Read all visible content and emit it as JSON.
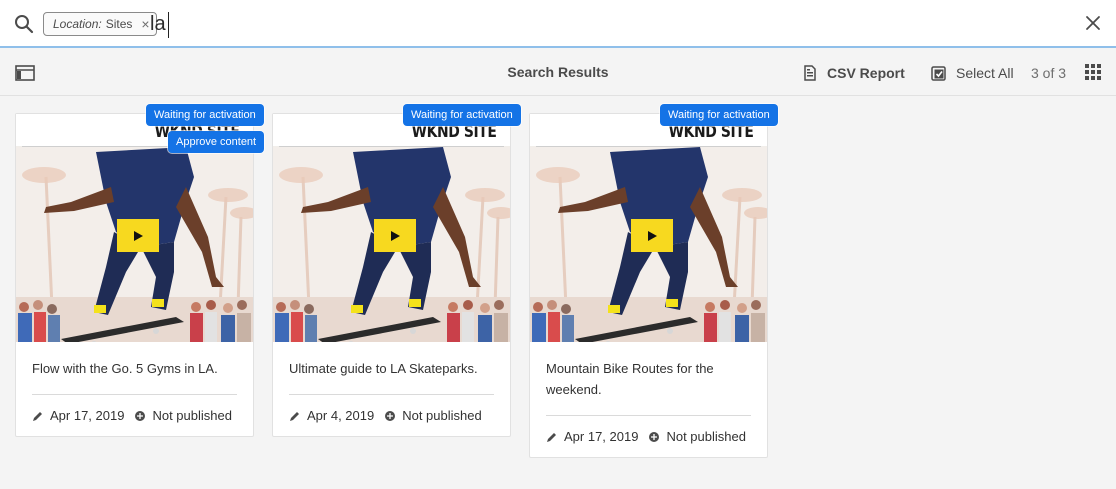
{
  "search": {
    "tag_key": "Location:",
    "tag_value": "Sites",
    "query": "la"
  },
  "actionbar": {
    "title": "Search Results",
    "csv_label": "CSV Report",
    "select_all_label": "Select All",
    "count": "3 of 3"
  },
  "cards": [
    {
      "brand": "WKND SITE",
      "title": "Flow with the Go. 5 Gyms in LA.",
      "date": "Apr 17, 2019",
      "status": "Not published",
      "badges": [
        "Waiting for activation",
        "Approve content"
      ]
    },
    {
      "brand": "WKND SITE",
      "title": "Ultimate guide to LA Skateparks.",
      "date": "Apr 4, 2019",
      "status": "Not published",
      "badges": [
        "Waiting for activation"
      ]
    },
    {
      "brand": "WKND SITE",
      "title": "Mountain Bike Routes for the weekend.",
      "date": "Apr 17, 2019",
      "status": "Not published",
      "badges": [
        "Waiting for activation"
      ]
    }
  ],
  "colors": {
    "accent": "#1473e6",
    "play_button": "#f7d91f",
    "focus_underline": "#8fbfea"
  },
  "icons": [
    "search-icon",
    "close-icon",
    "rail-toggle-icon",
    "csv-report-icon",
    "select-all-icon",
    "card-view-icon",
    "play-icon",
    "pencil-icon",
    "publish-status-icon"
  ]
}
